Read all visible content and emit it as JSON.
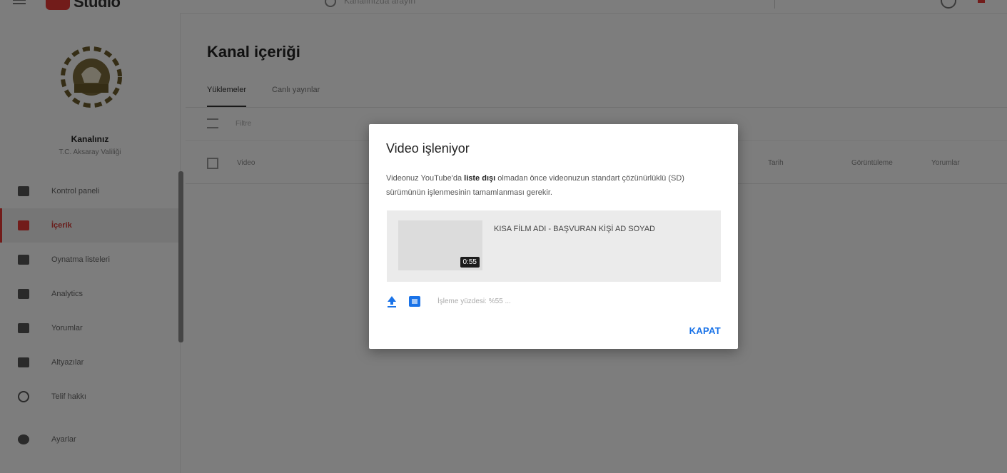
{
  "app": {
    "logo_text": "Studio"
  },
  "search": {
    "placeholder": "Kanalınızda arayın"
  },
  "channel": {
    "title": "Kanalınız",
    "subtitle": "T.C. Aksaray Valiliği"
  },
  "sidebar": {
    "items": [
      {
        "label": "Kontrol paneli",
        "icon": "dashboard-icon"
      },
      {
        "label": "İçerik",
        "icon": "content-icon",
        "active": true
      },
      {
        "label": "Oynatma listeleri",
        "icon": "playlist-icon"
      },
      {
        "label": "Analytics",
        "icon": "analytics-icon"
      },
      {
        "label": "Yorumlar",
        "icon": "comments-icon"
      },
      {
        "label": "Altyazılar",
        "icon": "subtitles-icon"
      },
      {
        "label": "Telif hakkı",
        "icon": "copyright-icon"
      },
      {
        "label": "Ayarlar",
        "icon": "gear-icon"
      }
    ]
  },
  "main": {
    "title": "Kanal içeriği",
    "tabs": [
      {
        "label": "Yüklemeler",
        "active": true
      },
      {
        "label": "Canlı yayınlar",
        "active": false
      }
    ],
    "filter_placeholder": "Filtre",
    "columns": {
      "video": "Video",
      "date": "Tarih",
      "views": "Görüntüleme",
      "comments": "Yorumlar"
    }
  },
  "dialog": {
    "title": "Video işleniyor",
    "message_prefix": "Videonuz YouTube'da ",
    "message_bold": "liste dışı",
    "message_suffix": " olmadan önce videonuzun standart çözünürlüklü (SD) sürümünün işlenmesinin tamamlanması gerekir.",
    "video": {
      "title": "KISA FİLM ADI - BAŞVURAN KİŞİ AD SOYAD",
      "duration": "0:55"
    },
    "progress_text": "İşleme yüzdesi: %55 ...",
    "close_label": "KAPAT"
  },
  "colors": {
    "accent": "#1a73e8",
    "brand_red": "#e53935"
  }
}
